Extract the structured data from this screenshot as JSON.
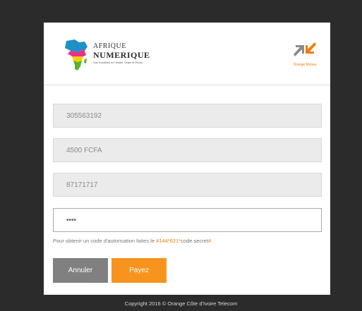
{
  "brand": {
    "line1": "AFRIQUE",
    "line2": "NUMERIQUE",
    "tagline": "Vos Solutions en Textile, Objet et Photo"
  },
  "partner": {
    "label": "Orange Money",
    "accent": "#f07c00"
  },
  "form": {
    "fields": [
      {
        "value": "305563192"
      },
      {
        "value": "4500 FCFA"
      },
      {
        "value": "87171717"
      },
      {
        "value": "••••"
      }
    ],
    "hint_prefix": "Pour obtenir un code d'autorisation faites le ",
    "hint_code": "#144*621*",
    "hint_mid": "code secret",
    "hint_suffix": "#"
  },
  "buttons": {
    "cancel_label": "Annuler",
    "pay_label": "Payez",
    "cancel_color": "#808080",
    "pay_color": "#f7941d"
  },
  "footer": {
    "text": "Copyright 2016 © Orange Côte d'Ivoire Telecom"
  }
}
